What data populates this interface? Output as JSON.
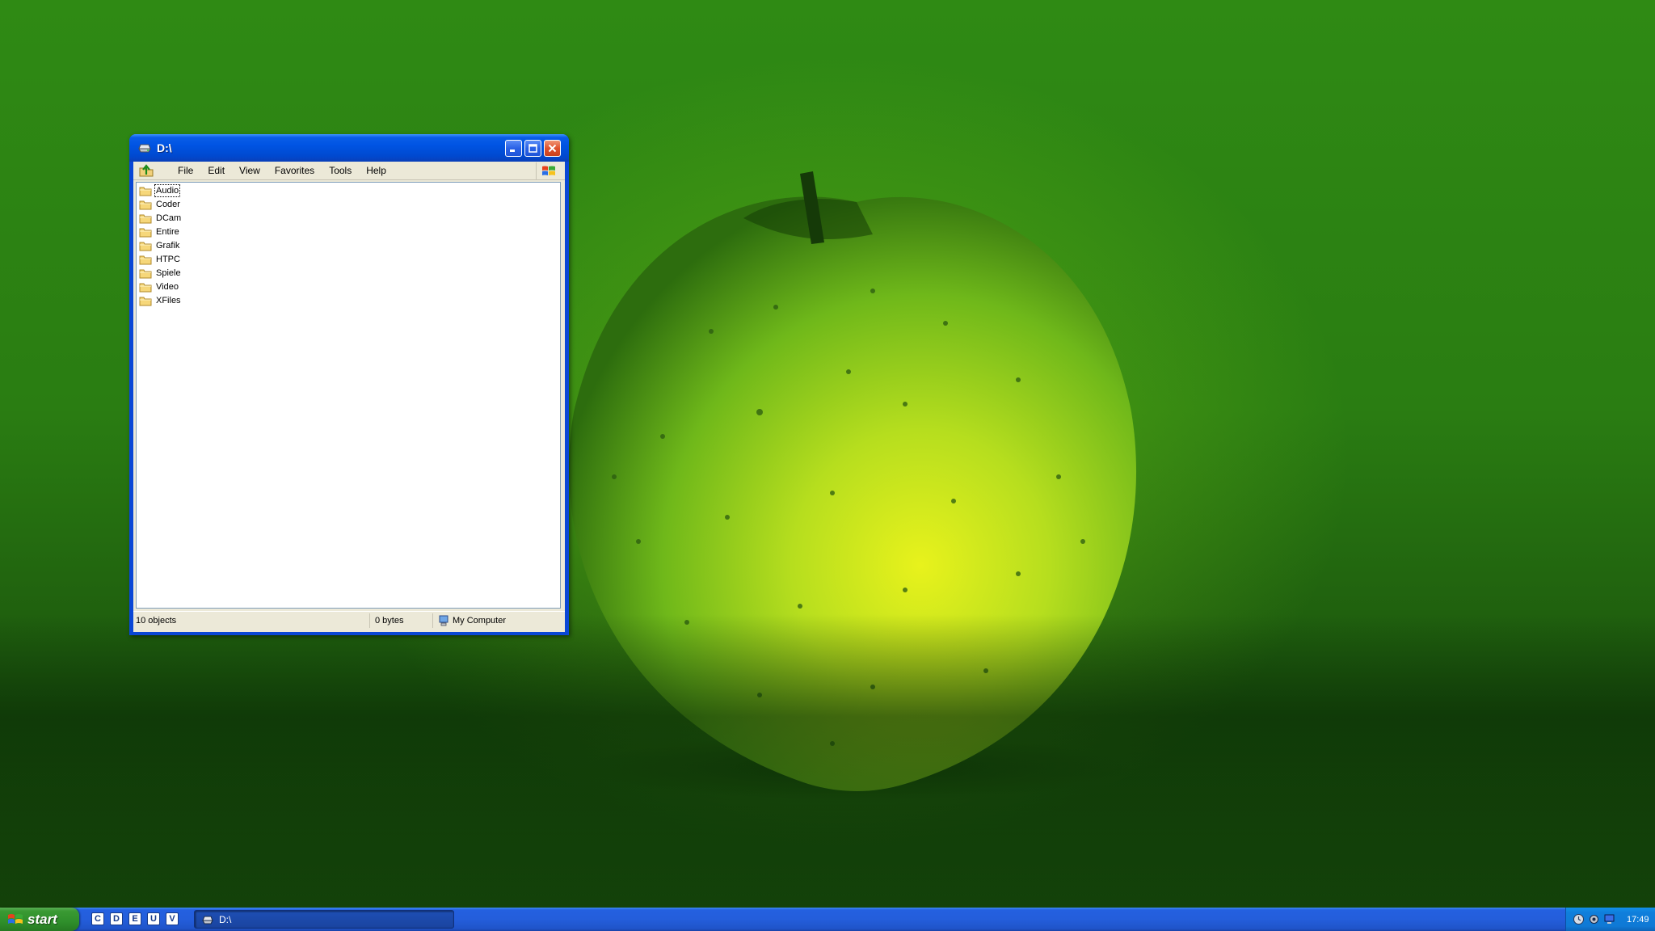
{
  "window": {
    "title": "D:\\",
    "menu": [
      {
        "label": "File",
        "name": "menu-file"
      },
      {
        "label": "Edit",
        "name": "menu-edit"
      },
      {
        "label": "View",
        "name": "menu-view"
      },
      {
        "label": "Favorites",
        "name": "menu-favorites"
      },
      {
        "label": "Tools",
        "name": "menu-tools"
      },
      {
        "label": "Help",
        "name": "menu-help"
      }
    ],
    "items": [
      {
        "label": "Audio",
        "icon": "folder-icon",
        "focused": true
      },
      {
        "label": "Coder",
        "icon": "folder-icon"
      },
      {
        "label": "DCam",
        "icon": "folder-icon"
      },
      {
        "label": "Entire",
        "icon": "folder-icon"
      },
      {
        "label": "Grafik",
        "icon": "folder-icon"
      },
      {
        "label": "HTPC",
        "icon": "folder-icon"
      },
      {
        "label": "Spiele",
        "icon": "folder-icon"
      },
      {
        "label": "Video",
        "icon": "folder-icon"
      },
      {
        "label": "XFiles",
        "icon": "folder-icon"
      }
    ],
    "status": {
      "objects": "10 objects",
      "size": "0 bytes",
      "zone": "My Computer"
    }
  },
  "taskbar": {
    "start_label": "start",
    "quicklaunch": [
      "C",
      "D",
      "E",
      "U",
      "V"
    ],
    "task_button_label": "D:\\",
    "clock": "17:49"
  },
  "colors": {
    "titlebar": "#0054e3",
    "taskbar": "#245edb",
    "start_button": "#3a9a33",
    "tray": "#0f7fdc",
    "wallpaper": "#2a7d12"
  }
}
